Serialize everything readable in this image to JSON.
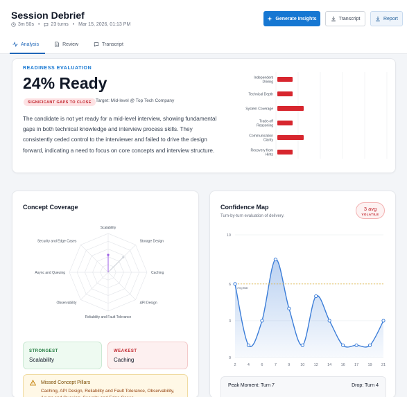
{
  "header": {
    "title": "Session Debrief",
    "duration": "3m 50s",
    "turns": "23 turns",
    "date": "Mar 15, 2026, 01:13 PM",
    "buttons": {
      "insights": "Generate Insights",
      "transcript": "Transcript",
      "report": "Report"
    },
    "accent": "#1677d2"
  },
  "tabs": [
    {
      "label": "Analysis",
      "icon": "activity-icon",
      "active": true
    },
    {
      "label": "Review",
      "icon": "document-icon",
      "active": false
    },
    {
      "label": "Transcript",
      "icon": "chat-icon",
      "active": false
    }
  ],
  "readiness": {
    "label": "READINESS EVALUATION",
    "percent_text": "24% Ready",
    "badge": "SIGNIFICANT GAPS TO CLOSE",
    "target": "Target: Mid-level @ Top Tech Company",
    "summary": "The candidate is not yet ready for a mid-level interview, showing fundamental gaps in both technical knowledge and interview process skills. They consistently ceded control to the interviewer and failed to drive the design forward, indicating a need to focus on core concepts and interview structure."
  },
  "chart_data": [
    {
      "type": "bar",
      "orientation": "horizontal",
      "categories": [
        "Independent Driving",
        "Technical Depth",
        "System Coverage",
        "Trade-off Reasoning",
        "Communication Clarity",
        "Recovery from Hints"
      ],
      "category_lines": [
        [
          "Independent",
          "Driving"
        ],
        [
          "Technical Depth"
        ],
        [
          "System Coverage"
        ],
        [
          "Trade-off",
          "Reasoning"
        ],
        [
          "Communication",
          "Clarity"
        ],
        [
          "Recovery from",
          "Hints"
        ]
      ],
      "values": [
        1.0,
        1.0,
        2.0,
        1.0,
        2.0,
        1.0
      ],
      "xlim": [
        0,
        10
      ],
      "grid": true,
      "bar_color": "#d7262e"
    },
    {
      "type": "radar",
      "axes": [
        "Scalability",
        "Storage Design",
        "Caching",
        "API Design",
        "Reliability and Fault Tolerance",
        "Observability",
        "Async and Queuing",
        "Security and Edge Cases"
      ],
      "values": [
        4.5,
        0,
        0,
        0,
        0,
        0,
        0,
        0
      ],
      "max": 10,
      "secondary_values": [
        0,
        5.5,
        0,
        0,
        0,
        0,
        0,
        0
      ],
      "fill_color": "#9b5de5"
    },
    {
      "type": "line",
      "title": "Confidence Map",
      "subtitle": "Turn-by-turn evaluation of delivery.",
      "x": [
        2,
        4,
        6,
        7,
        9,
        10,
        12,
        14,
        16,
        17,
        19,
        21
      ],
      "y": [
        6,
        1,
        3,
        8,
        4,
        1,
        5,
        3,
        1,
        1,
        1,
        3
      ],
      "xticks": [
        2,
        4,
        6,
        7,
        9,
        10,
        12,
        14,
        16,
        17,
        19,
        21
      ],
      "yticks": [
        0,
        3,
        6,
        10
      ],
      "ylim": [
        0,
        10
      ],
      "avg_value": 6,
      "avg_label": "Avg Bar",
      "line_color": "#3b7dd8"
    }
  ],
  "concept": {
    "title": "Concept Coverage",
    "strongest_label": "STRONGEST",
    "strongest_value": "Scalability",
    "weakest_label": "WEAKEST",
    "weakest_value": "Caching",
    "missed_title": "Missed Concept Pillars",
    "missed_text": "Caching, API Design, Reliability and Fault Tolerance, Observability, Async and Queuing, Security and Edge Cases"
  },
  "confidence": {
    "title": "Confidence Map",
    "subtitle": "Turn-by-turn evaluation of delivery.",
    "avg_text": "3 avg",
    "volatility": "VOLATILE",
    "peak": "Peak Moment: Turn 7",
    "drop": "Drop: Turn 4"
  }
}
